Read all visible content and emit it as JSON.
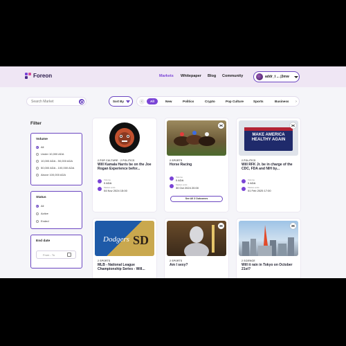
{
  "header": {
    "brand": "Foreon",
    "nav": [
      {
        "label": "Markets",
        "active": true
      },
      {
        "label": "Whitepaper",
        "active": false
      },
      {
        "label": "Blog",
        "active": false
      },
      {
        "label": "Community",
        "active": false
      }
    ],
    "user": {
      "name": "addr_t ... j3mw",
      "avatar_icon": "avatar"
    }
  },
  "search": {
    "placeholder": "Search Market",
    "icon": "search-icon"
  },
  "sort": {
    "label": "Sort By",
    "icon": "funnel-icon"
  },
  "tabs": {
    "prev_icon": "chevron-left-icon",
    "next_icon": "chevron-right-icon",
    "items": [
      "All",
      "New",
      "Politics",
      "Crypto",
      "Pop Culture",
      "Sports",
      "Business"
    ],
    "active_index": 0
  },
  "filter": {
    "title": "Filter",
    "volume": {
      "title": "Volume",
      "options": [
        "All",
        "Under 10,000 ADA",
        "10,000 ADA - 50,000 ADA",
        "50,000 ADA - 100,000 ADA",
        "Above 100,000 ADA"
      ],
      "selected": 0
    },
    "status": {
      "title": "Status",
      "options": [
        "All",
        "Active",
        "Ended"
      ],
      "selected": 0
    },
    "end_date": {
      "title": "End date",
      "placeholder": "From - To",
      "icon": "calendar-icon"
    }
  },
  "cards": [
    {
      "category": "2 POP CULTURE · 2 POLITICS",
      "title": "Will Kamala Harris be on the Joe Rogan Experience befor...",
      "volume_label": "Volume",
      "volume": "0 ADA",
      "end_label": "Market ends",
      "end": "04 Nov 2024 15:00"
    },
    {
      "category": "2 SPORTS",
      "title": "Horse Racing",
      "volume_label": "Volume",
      "volume": "0 ADA",
      "end_label": "Market ends",
      "end": "30 Oct 2024 20:00",
      "button": "See All 3 Outcomes"
    },
    {
      "category": "2 POLITICS",
      "title": "Will RFK Jr. be in charge of the CDC, FDA and NIH by...",
      "volume_label": "Volume",
      "volume": "0 ADA",
      "end_label": "Market ends",
      "end": "01 Feb 2025 17:00",
      "image_text": "MAKE AMERICA HEALTHY AGAIN"
    },
    {
      "category": "2 SPORTS",
      "title": "MLB - National League Championship Series - Will..."
    },
    {
      "category": "2 SPORTS",
      "title": "Am I sexy?"
    },
    {
      "category": "2 SCIENCE",
      "title": "Will it rain in Tokyo on October 21st?"
    }
  ],
  "colors": {
    "accent": "#7a44d6",
    "border": "#6b46c1",
    "header_bg": "#efe6f4",
    "page_bg": "#f5f5f9"
  }
}
